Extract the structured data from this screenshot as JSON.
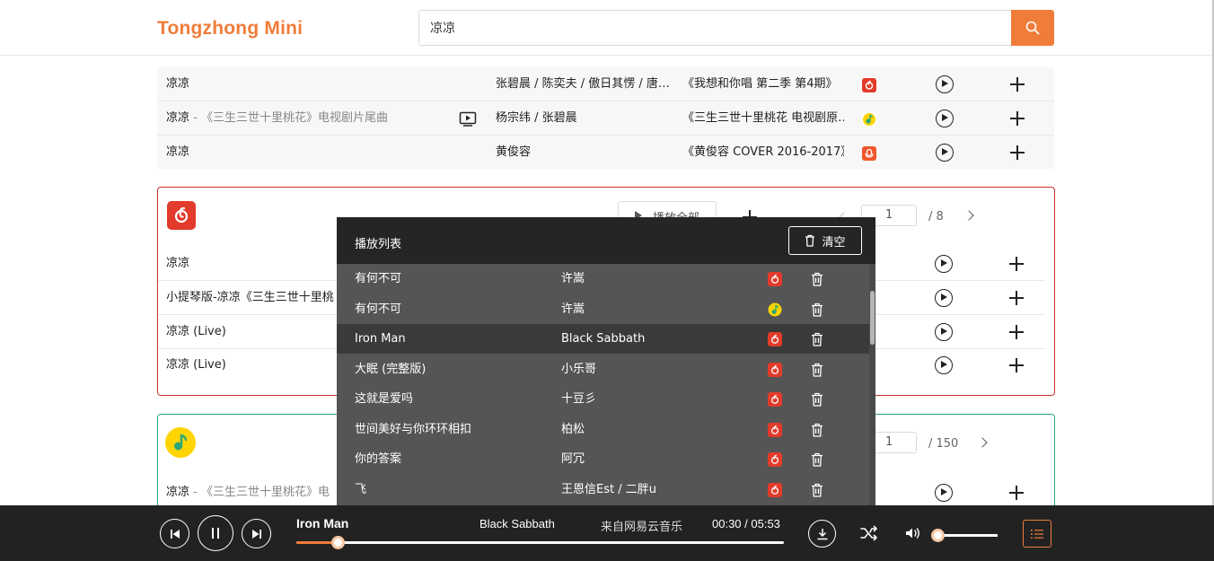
{
  "app": {
    "brand": "Tongzhong Mini"
  },
  "search": {
    "value": "凉凉"
  },
  "top_results": [
    {
      "title": "凉凉",
      "subtitle": "",
      "artist": "张碧晨 / 陈奕夫 / 傲日其愣 / 唐…",
      "album": "《我想和你唱 第二季 第4期》",
      "source": "netease",
      "mv": false
    },
    {
      "title": "凉凉",
      "subtitle": " - 《三生三世十里桃花》电视剧片尾曲",
      "artist": "杨宗纬 / 张碧晨",
      "album": "《三生三世十里桃花 电视剧原…",
      "source": "qq",
      "mv": true
    },
    {
      "title": "凉凉",
      "subtitle": "",
      "artist": "黄俊容",
      "album": "《黄俊容 COVER 2016-2017》",
      "source": "xiami",
      "mv": false
    }
  ],
  "netease_panel": {
    "play_all_label": "播放全部",
    "page_input": "1",
    "page_total": "/ 8",
    "rows": [
      {
        "title": "凉凉"
      },
      {
        "title": "小提琴版-凉凉《三生三世十里桃"
      },
      {
        "title": "凉凉 (Live)"
      },
      {
        "title": "凉凉 (Live)"
      }
    ]
  },
  "qq_panel": {
    "page_input": "1",
    "page_total": "/ 150",
    "rows": [
      {
        "title": "凉凉",
        "subtitle": " - 《三生三世十里桃花》电"
      }
    ]
  },
  "playlist": {
    "title": "播放列表",
    "clear_label": "清空",
    "items": [
      {
        "title": "有何不可",
        "artist": "许嵩",
        "source": "netease",
        "active": false
      },
      {
        "title": "有何不可",
        "artist": "许嵩",
        "source": "qq",
        "active": false
      },
      {
        "title": "Iron Man",
        "artist": "Black Sabbath",
        "source": "netease",
        "active": true
      },
      {
        "title": "大眠 (完整版)",
        "artist": "小乐哥",
        "source": "netease",
        "active": false
      },
      {
        "title": "这就是爱吗",
        "artist": "十豆彡",
        "source": "netease",
        "active": false
      },
      {
        "title": "世间美好与你环环相扣",
        "artist": "柏松",
        "source": "netease",
        "active": false
      },
      {
        "title": "你的答案",
        "artist": "阿冗",
        "source": "netease",
        "active": false
      },
      {
        "title": "飞",
        "artist": "王恩信Est / 二胖u",
        "source": "netease",
        "active": false
      }
    ]
  },
  "player": {
    "title": "Iron Man",
    "artist": "Black Sabbath",
    "source_label": "来自网易云音乐",
    "time": "00:30 / 05:53",
    "progress": 0.085,
    "volume": 0.1
  },
  "colors": {
    "accent": "#f07c3a",
    "netease": "#e23b2b",
    "qq_border": "#2aa775",
    "qq_yellow": "#ffd400",
    "player_bg": "#222222",
    "playlist_bg": "#555555"
  }
}
